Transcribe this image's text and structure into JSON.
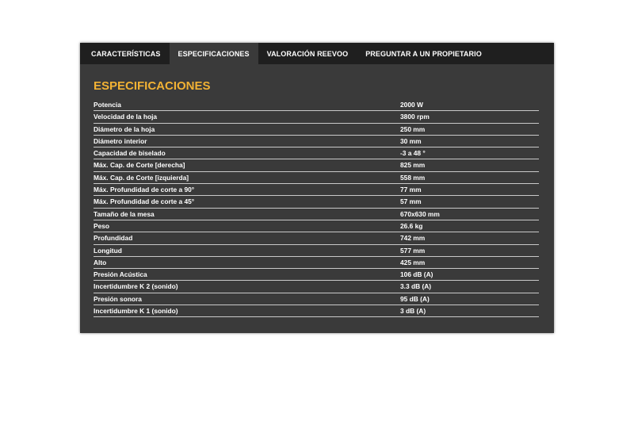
{
  "tabs": [
    {
      "label": "CARACTERÍSTICAS",
      "active": false
    },
    {
      "label": "ESPECIFICACIONES",
      "active": true
    },
    {
      "label": "VALORACIÓN REEVOO",
      "active": false
    },
    {
      "label": "PREGUNTAR A UN PROPIETARIO",
      "active": false
    }
  ],
  "section": {
    "title": "ESPECIFICACIONES"
  },
  "specs": [
    {
      "label": "Potencia",
      "value": "2000 W"
    },
    {
      "label": "Velocidad de la hoja",
      "value": "3800 rpm"
    },
    {
      "label": "Diámetro de la hoja",
      "value": "250 mm"
    },
    {
      "label": "Diámetro interior",
      "value": "30 mm"
    },
    {
      "label": "Capacidad de biselado",
      "value": "-3 a 48 °"
    },
    {
      "label": "Máx. Cap. de Corte [derecha]",
      "value": "825 mm"
    },
    {
      "label": "Máx. Cap. de Corte [izquierda]",
      "value": "558 mm"
    },
    {
      "label": "Máx. Profundidad de corte a 90°",
      "value": "77 mm"
    },
    {
      "label": "Máx. Profundidad de corte a 45°",
      "value": "57 mm"
    },
    {
      "label": "Tamaño de la mesa",
      "value": "670x630 mm"
    },
    {
      "label": "Peso",
      "value": "26.6 kg"
    },
    {
      "label": "Profundidad",
      "value": "742 mm"
    },
    {
      "label": "Longitud",
      "value": "577 mm"
    },
    {
      "label": "Alto",
      "value": "425 mm"
    },
    {
      "label": "Presión Acústica",
      "value": "106 dB (A)"
    },
    {
      "label": "Incertidumbre K 2 (sonido)",
      "value": "3.3 dB (A)"
    },
    {
      "label": "Presión sonora",
      "value": "95 dB (A)"
    },
    {
      "label": "Incertidumbre K 1 (sonido)",
      "value": "3 dB (A)"
    }
  ],
  "colors": {
    "accent": "#f2b234",
    "panel": "#3a3a3a",
    "tabbar": "#1f1f1f"
  }
}
